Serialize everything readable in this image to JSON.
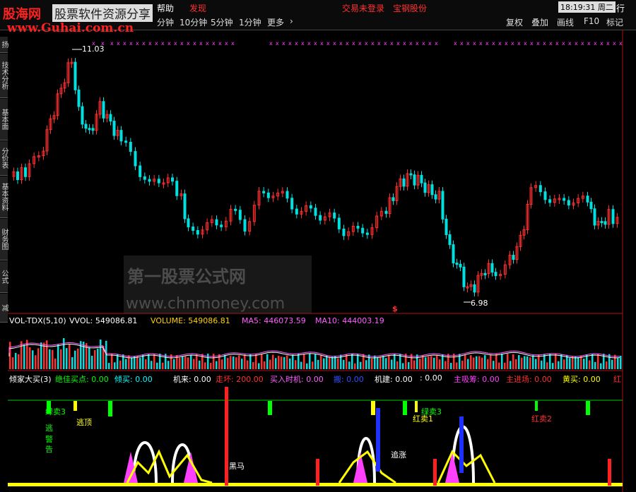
{
  "app": {
    "logo_cn": "股海网",
    "logo_banner": "股票软件资源分享",
    "logo_url": "www.Guhai.com.cn"
  },
  "topbar": {
    "menu_help": "帮助",
    "menu_discover": "发现",
    "login_status": "交易未登录",
    "stock_name": "宝钢股份",
    "clock": "18:19:31 周二",
    "right_tab": "行"
  },
  "toolbar": {
    "periods": [
      "分钟",
      "10分钟",
      "5分钟",
      "1分钟",
      "更多"
    ],
    "more_arrow": "›",
    "right_buttons": [
      "复权",
      "叠加",
      "画线",
      "F10",
      "标记"
    ]
  },
  "side_tabs": [
    "扬",
    "技术分析",
    "基本面",
    "分价表",
    "基本资料",
    "财务图",
    "公式",
    "减"
  ],
  "price_chart": {
    "high_label": "11.03",
    "low_label": "6.98",
    "dollar_mark": "$",
    "up_color": "#ff3030",
    "down_color": "#00e0e0",
    "axis_color": "#b01010"
  },
  "watermark": {
    "line1": "第一股票公式网",
    "line2": "www.chnmoney.com"
  },
  "volume_panel": {
    "indicator": "VOL-TDX(5,10)",
    "vvol": "VVOL: 549086.81",
    "volume": "VOLUME: 549086.81",
    "ma5": "MA5: 446073.59",
    "ma10": "MA10: 444003.19",
    "colors": {
      "vvol": "#ffffff",
      "volume": "#ffd000",
      "ma5": "#ff60ff",
      "ma10": "#ff60ff"
    }
  },
  "indicator_panel": {
    "title": "倾家大买(3)",
    "items": [
      {
        "text": "绝佳买点: 0.00",
        "color": "#00ff00"
      },
      {
        "text": "倾买: 0.00",
        "color": "#00ffff"
      },
      {
        "text": "机来: 0.00",
        "color": "#ffffff"
      },
      {
        "text": "走坏: 200.00",
        "color": "#ff3030"
      },
      {
        "text": "买入时机: 0.00",
        "color": "#ff60ff"
      },
      {
        "text": "搬: 0.00",
        "color": "#3050ff"
      },
      {
        "text": "机建: 0.00",
        "color": "#ffffff"
      },
      {
        "text": ": 0.00",
        "color": "#ffffff"
      },
      {
        "text": "主吸筹: 0.00",
        "color": "#ff40ff"
      },
      {
        "text": "主进场: 0.00",
        "color": "#ff3030"
      },
      {
        "text": "黄买: 0.00",
        "color": "#ffff00"
      },
      {
        "text": "红",
        "color": "#ff3030"
      }
    ],
    "annotations": [
      {
        "text": "绿卖3",
        "color": "#00ff00"
      },
      {
        "text": "逃顶",
        "color": "#ffff00"
      },
      {
        "text": "逃",
        "color": "#00ff00"
      },
      {
        "text": "警",
        "color": "#00ff00"
      },
      {
        "text": "告",
        "color": "#00ff00"
      },
      {
        "text": "黑马",
        "color": "#ffffff"
      },
      {
        "text": "追涨",
        "color": "#ffffff"
      },
      {
        "text": "红卖1",
        "color": "#ffff00"
      },
      {
        "text": "红卖2",
        "color": "#ff3030"
      },
      {
        "text": "绿卖3",
        "color": "#00ff00"
      }
    ]
  }
}
